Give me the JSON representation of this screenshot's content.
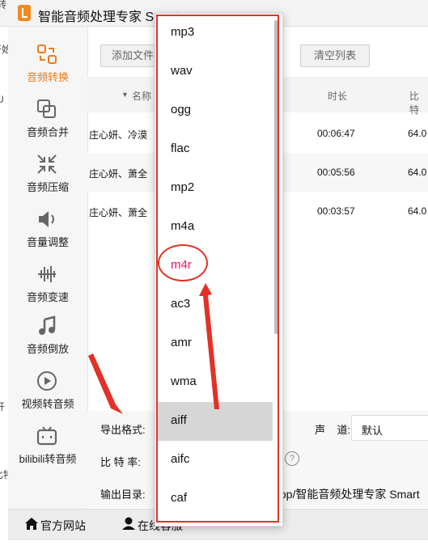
{
  "window": {
    "title": "智能音频处理专家 Smart"
  },
  "background_edge_texts": [
    "转",
    "U",
    "开始",
    "比特",
    "开"
  ],
  "sidebar": {
    "items": [
      {
        "label": "音频转换",
        "icon": "convert-icon",
        "active": true
      },
      {
        "label": "音频合并",
        "icon": "merge-icon"
      },
      {
        "label": "音频压缩",
        "icon": "compress-icon"
      },
      {
        "label": "音量调整",
        "icon": "volume-icon"
      },
      {
        "label": "音频变速",
        "icon": "speed-icon"
      },
      {
        "label": "音频倒放",
        "icon": "reverse-icon"
      },
      {
        "label": "视频转音频",
        "icon": "video-play-icon"
      },
      {
        "label": "bilibili转音频",
        "icon": "bilibili-icon"
      }
    ]
  },
  "toolbar": {
    "add_file_label": "添加文件",
    "clear_list_label": "清空列表"
  },
  "table": {
    "columns": {
      "name": "名称",
      "duration": "时长",
      "bitrate": "比特"
    },
    "rows": [
      {
        "name": "庄心妍、冷漠",
        "duration": "00:06:47",
        "bitrate": "64.0"
      },
      {
        "name": "庄心妍、萧全",
        "duration": "00:05:56",
        "bitrate": "64.0"
      },
      {
        "name": "庄心妍、萧全",
        "duration": "00:03:57",
        "bitrate": "64.0"
      }
    ]
  },
  "settings": {
    "format_label": "导出格式:",
    "bitrate_label": "比 特 率:",
    "output_label": "输出目录:",
    "output_path": "top/智能音频处理专家 Smart",
    "channel_label": "声    道:",
    "channel_value": "默认"
  },
  "bottom_bar": {
    "website_label": "官方网站",
    "support_label": "在线客服"
  },
  "dropdown": {
    "options": [
      "mp3",
      "wav",
      "ogg",
      "flac",
      "mp2",
      "m4a",
      "m4r",
      "ac3",
      "amr",
      "wma",
      "aiff",
      "aifc",
      "caf"
    ],
    "highlighted": "m4r",
    "hovered": "aiff"
  },
  "colors": {
    "accent_orange": "#f07a1a",
    "annotation_red": "#e33127",
    "highlight_pink": "#e8175d"
  }
}
